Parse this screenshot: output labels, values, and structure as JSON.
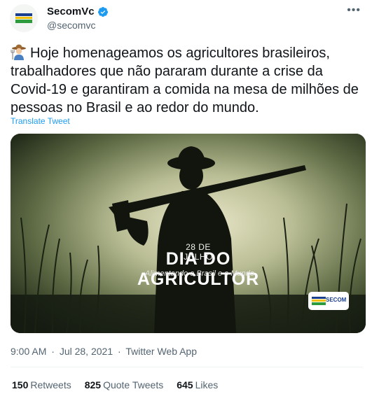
{
  "author": {
    "display_name": "SecomVc",
    "handle": "@secomvc",
    "verified": true,
    "avatar_icon": "secom-logo-icon",
    "more_icon": "more-options-icon"
  },
  "tweet": {
    "emoji_icon": "farmer-emoji-icon",
    "text": "Hoje homenageamos os agricultores brasileiros, trabalhadores que não pararam durante a crise da Covid-19 e garantiram a comida na mesa de milhões de pessoas no Brasil e ao redor do mundo.",
    "translate_label": "Translate Tweet"
  },
  "media": {
    "date_text": "28 DE JULHO",
    "title_text": "DIA DO AGRICULTOR",
    "subtitle_text": "Alimentando o Brasil e o Mundo",
    "badge_text": "SECOM"
  },
  "meta": {
    "time": "9:00 AM",
    "separator": "·",
    "date": "Jul 28, 2021",
    "source": "Twitter Web App"
  },
  "stats": {
    "retweets_count": "150",
    "retweets_label": "Retweets",
    "quotes_count": "825",
    "quotes_label": "Quote Tweets",
    "likes_count": "645",
    "likes_label": "Likes"
  },
  "colors": {
    "link": "#1d9bf0",
    "verified": "#1d9bf0",
    "secondary_text": "#536471",
    "primary_text": "#0f1419"
  }
}
